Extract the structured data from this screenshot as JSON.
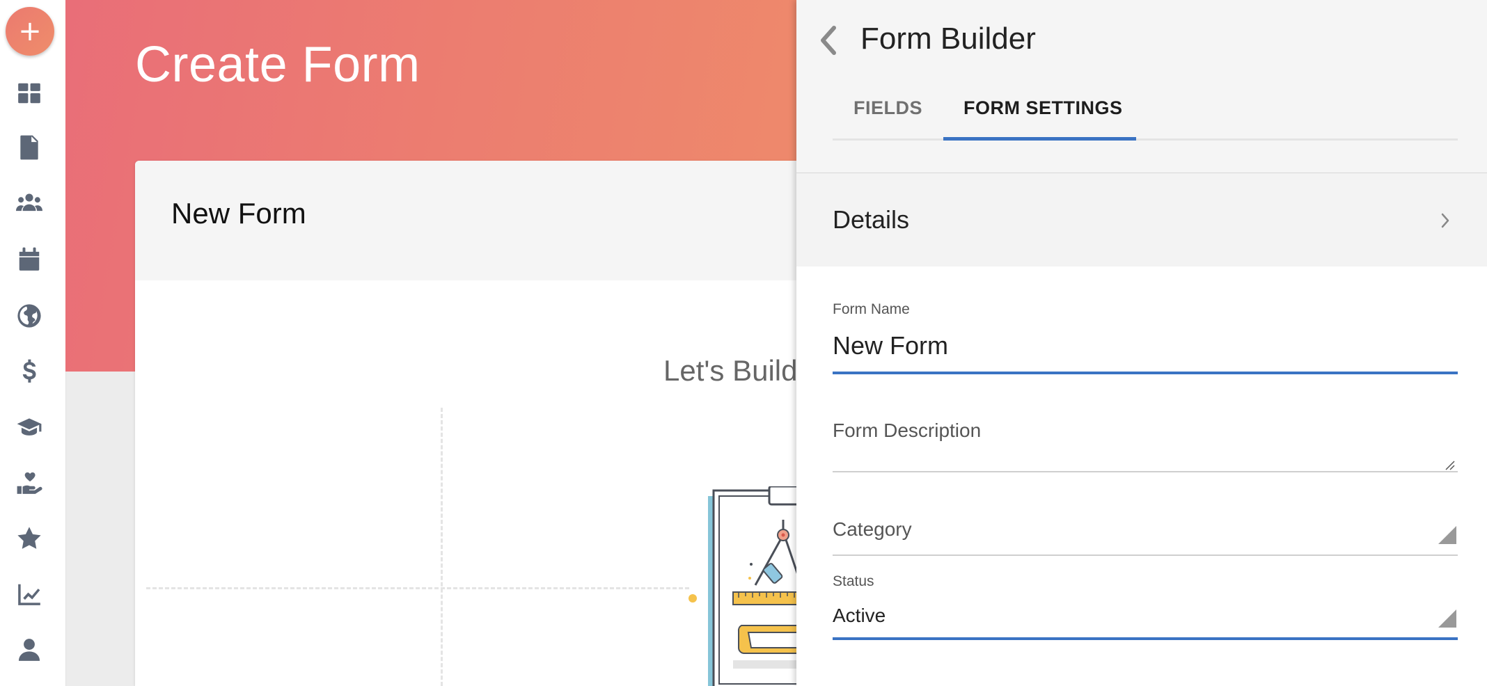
{
  "rail": {
    "fab_label": "+",
    "icons": [
      "dashboard-icon",
      "document-icon",
      "users-icon",
      "calendar-icon",
      "globe-icon",
      "dollar-icon",
      "graduation-cap-icon",
      "hand-heart-icon",
      "star-icon",
      "chart-line-icon",
      "user-icon"
    ]
  },
  "main": {
    "page_title": "Create Form",
    "card_title": "New Form",
    "empty_message": "Let's Build"
  },
  "panel": {
    "title": "Form Builder",
    "tabs": [
      {
        "label": "FIELDS",
        "active": false
      },
      {
        "label": "FORM SETTINGS",
        "active": true
      }
    ],
    "details_label": "Details",
    "form_name": {
      "label": "Form Name",
      "value": "New Form"
    },
    "form_description": {
      "placeholder": "Form Description",
      "value": ""
    },
    "category": {
      "placeholder": "Category",
      "value": ""
    },
    "status": {
      "label": "Status",
      "value": "Active"
    }
  },
  "colors": {
    "accent": "#3a73c3",
    "hero_start": "#e96e78",
    "hero_end": "#ee8a6b",
    "icon": "#5d6777"
  }
}
